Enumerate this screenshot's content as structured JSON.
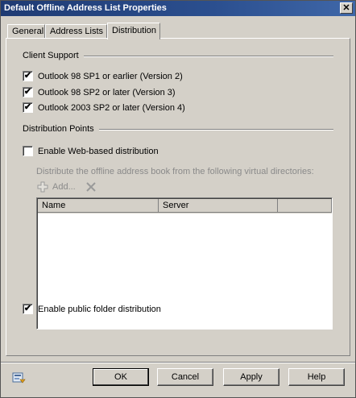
{
  "window": {
    "title": "Default Offline Address List Properties",
    "close_glyph": "✕"
  },
  "tabs": [
    {
      "label": "General"
    },
    {
      "label": "Address Lists"
    },
    {
      "label": "Distribution"
    }
  ],
  "client_support": {
    "label": "Client Support",
    "options": [
      {
        "label": "Outlook 98 SP1 or earlier (Version 2)",
        "checked": true
      },
      {
        "label": "Outlook 98 SP2 or later (Version 3)",
        "checked": true
      },
      {
        "label": "Outlook 2003 SP2 or later (Version 4)",
        "checked": true
      }
    ]
  },
  "distribution_points": {
    "label": "Distribution Points",
    "web_distribution": {
      "label": "Enable Web-based distribution",
      "checked": false
    },
    "virtual_dirs_label": "Distribute the offline address book from the following virtual directories:",
    "add_label": "Add...",
    "list_columns": [
      "Name",
      "Server"
    ],
    "public_folder": {
      "label": "Enable public folder distribution",
      "checked": true
    }
  },
  "buttons": {
    "ok": "OK",
    "cancel": "Cancel",
    "apply": "Apply",
    "help": "Help"
  },
  "check_glyph": "✔"
}
